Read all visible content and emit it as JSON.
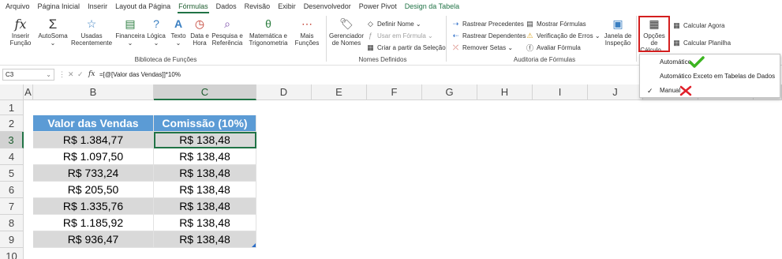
{
  "tabs": [
    "Arquivo",
    "Página Inicial",
    "Inserir",
    "Layout da Página",
    "Fórmulas",
    "Dados",
    "Revisão",
    "Exibir",
    "Desenvolvedor",
    "Power Pivot",
    "Design da Tabela"
  ],
  "ribbon": {
    "insert_function": [
      "Inserir",
      "Função"
    ],
    "autosum": "AutoSoma",
    "recent": [
      "Usadas",
      "Recentemente"
    ],
    "financial": "Financeira",
    "logical": "Lógica",
    "text": "Texto",
    "datetime": [
      "Data e",
      "Hora"
    ],
    "lookup": [
      "Pesquisa e",
      "Referência"
    ],
    "math": [
      "Matemática e",
      "Trigonometria"
    ],
    "more": [
      "Mais",
      "Funções"
    ],
    "group_library": "Biblioteca de Funções",
    "name_manager": [
      "Gerenciador",
      "de Nomes"
    ],
    "define_name": "Definir Nome",
    "use_in_formula": "Usar em Fórmula",
    "create_from_selection": "Criar a partir da Seleção",
    "group_names": "Nomes Definidos",
    "trace_precedents": "Rastrear Precedentes",
    "trace_dependents": "Rastrear Dependentes",
    "remove_arrows": "Remover Setas",
    "show_formulas": "Mostrar Fórmulas",
    "error_checking": "Verificação de Erros",
    "evaluate_formula": "Avaliar Fórmula",
    "watch_window": [
      "Janela de",
      "Inspeção"
    ],
    "group_auditing": "Auditoria de Fórmulas",
    "calc_options": [
      "Opções de",
      "Cálculo"
    ],
    "calc_now": "Calcular Agora",
    "calc_sheet": "Calcular Planilha"
  },
  "calc_menu": {
    "items": [
      "Automático",
      "Automático Exceto em Tabelas de Dados",
      "Manual"
    ],
    "checked": "Manual",
    "mark_ok_color": "#3cb521",
    "mark_x_color": "#e0202a"
  },
  "formula_bar": {
    "name_box": "C3",
    "fx": "fx",
    "formula": "=[@[Valor das Vendas]]*10%"
  },
  "columns": [
    "A",
    "B",
    "C",
    "D",
    "E",
    "F",
    "G",
    "H",
    "I",
    "J",
    "K",
    "L",
    "M"
  ],
  "rows": [
    "1",
    "2",
    "3",
    "4",
    "5",
    "6",
    "7",
    "8",
    "9",
    "10"
  ],
  "table": {
    "headers": [
      "Valor das Vendas",
      "Comissão (10%)"
    ],
    "rows": [
      [
        "R$ 1.384,77",
        "R$ 138,48"
      ],
      [
        "R$ 1.097,50",
        "R$ 138,48"
      ],
      [
        "R$ 733,24",
        "R$ 138,48"
      ],
      [
        "R$ 205,50",
        "R$ 138,48"
      ],
      [
        "R$ 1.335,76",
        "R$ 138,48"
      ],
      [
        "R$ 1.185,92",
        "R$ 138,48"
      ],
      [
        "R$ 936,47",
        "R$ 138,48"
      ]
    ]
  },
  "colors": {
    "header_blue": "#5b9bd5",
    "band_gray": "#d9d9d9",
    "excel_green": "#217346",
    "highlight_red": "#d41f1f"
  }
}
